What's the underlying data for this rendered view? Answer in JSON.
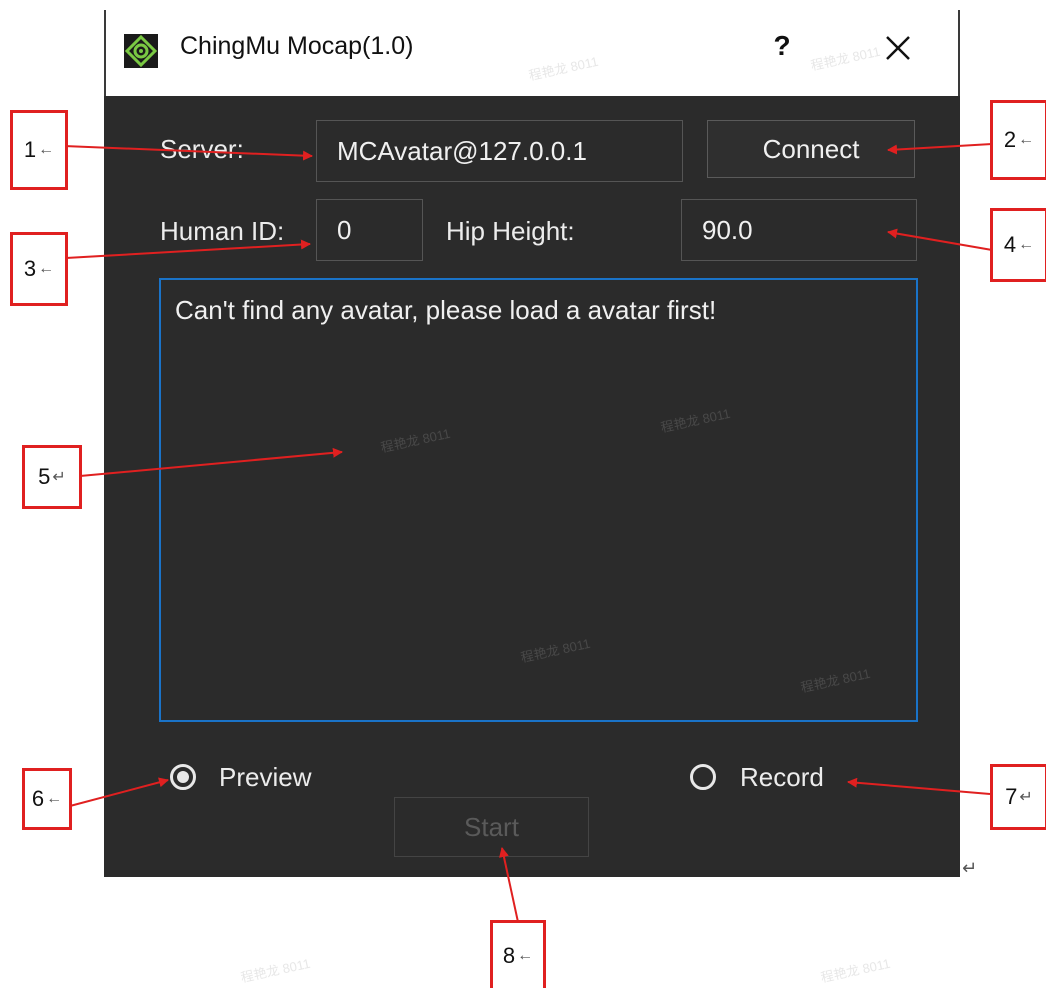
{
  "window": {
    "title": "ChingMu Mocap(1.0)",
    "help_label": "?"
  },
  "form": {
    "server_label": "Server:",
    "server_value": "MCAvatar@127.0.0.1",
    "connect_label": "Connect",
    "human_id_label": "Human ID:",
    "human_id_value": "0",
    "hip_height_label": "Hip Height:",
    "hip_height_value": "90.0"
  },
  "log": {
    "message": "Can't find any avatar, please load a avatar first!"
  },
  "mode": {
    "preview_label": "Preview",
    "preview_selected": true,
    "record_label": "Record",
    "record_selected": false
  },
  "start_label": "Start",
  "callouts": [
    {
      "label": "1",
      "mark": "←"
    },
    {
      "label": "2",
      "mark": "←"
    },
    {
      "label": "3",
      "mark": "←"
    },
    {
      "label": "4",
      "mark": "←"
    },
    {
      "label": "5",
      "mark": "↵"
    },
    {
      "label": "6",
      "mark": "←"
    },
    {
      "label": "7",
      "mark": "↵"
    },
    {
      "label": "8",
      "mark": "←"
    }
  ],
  "paragraph_mark": "↵",
  "watermark": "程艳龙 8011",
  "colors": {
    "window_bg": "#2b2b2b",
    "focus_border": "#1a73c8",
    "callout_red": "#e02020",
    "logo_green": "#7ac943"
  },
  "icons": {
    "app_icon": "chingmu-logo-icon",
    "close_icon": "close-x-icon"
  }
}
